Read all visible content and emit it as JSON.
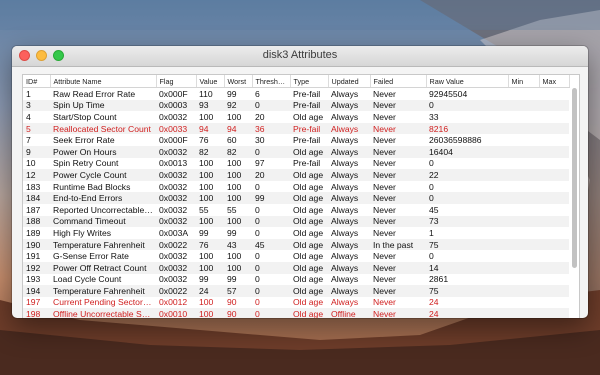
{
  "window": {
    "title": "disk3 Attributes"
  },
  "table": {
    "columns": [
      "ID#",
      "Attribute Name",
      "Flag",
      "Value",
      "Worst",
      "Threshold",
      "Type",
      "Updated",
      "Failed",
      "Raw Value",
      "Min",
      "Max"
    ],
    "rows": [
      {
        "id": "1",
        "name": "Raw Read Error Rate",
        "flag": "0x000F",
        "value": "110",
        "worst": "99",
        "threshold": "6",
        "type": "Pre-fail",
        "updated": "Always",
        "failed": "Never",
        "raw": "92945504",
        "min": "",
        "max": "",
        "warn": false
      },
      {
        "id": "3",
        "name": "Spin Up Time",
        "flag": "0x0003",
        "value": "93",
        "worst": "92",
        "threshold": "0",
        "type": "Pre-fail",
        "updated": "Always",
        "failed": "Never",
        "raw": "0",
        "min": "",
        "max": "",
        "warn": false
      },
      {
        "id": "4",
        "name": "Start/Stop Count",
        "flag": "0x0032",
        "value": "100",
        "worst": "100",
        "threshold": "20",
        "type": "Old age",
        "updated": "Always",
        "failed": "Never",
        "raw": "33",
        "min": "",
        "max": "",
        "warn": false
      },
      {
        "id": "5",
        "name": "Reallocated Sector Count",
        "flag": "0x0033",
        "value": "94",
        "worst": "94",
        "threshold": "36",
        "type": "Pre-fail",
        "updated": "Always",
        "failed": "Never",
        "raw": "8216",
        "min": "",
        "max": "",
        "warn": true
      },
      {
        "id": "7",
        "name": "Seek Error Rate",
        "flag": "0x000F",
        "value": "76",
        "worst": "60",
        "threshold": "30",
        "type": "Pre-fail",
        "updated": "Always",
        "failed": "Never",
        "raw": "26036598886",
        "min": "",
        "max": "",
        "warn": false
      },
      {
        "id": "9",
        "name": "Power On Hours",
        "flag": "0x0032",
        "value": "82",
        "worst": "82",
        "threshold": "0",
        "type": "Old age",
        "updated": "Always",
        "failed": "Never",
        "raw": "16404",
        "min": "",
        "max": "",
        "warn": false
      },
      {
        "id": "10",
        "name": "Spin Retry Count",
        "flag": "0x0013",
        "value": "100",
        "worst": "100",
        "threshold": "97",
        "type": "Pre-fail",
        "updated": "Always",
        "failed": "Never",
        "raw": "0",
        "min": "",
        "max": "",
        "warn": false
      },
      {
        "id": "12",
        "name": "Power Cycle Count",
        "flag": "0x0032",
        "value": "100",
        "worst": "100",
        "threshold": "20",
        "type": "Old age",
        "updated": "Always",
        "failed": "Never",
        "raw": "22",
        "min": "",
        "max": "",
        "warn": false
      },
      {
        "id": "183",
        "name": "Runtime Bad Blocks",
        "flag": "0x0032",
        "value": "100",
        "worst": "100",
        "threshold": "0",
        "type": "Old age",
        "updated": "Always",
        "failed": "Never",
        "raw": "0",
        "min": "",
        "max": "",
        "warn": false
      },
      {
        "id": "184",
        "name": "End-to-End Errors",
        "flag": "0x0032",
        "value": "100",
        "worst": "100",
        "threshold": "99",
        "type": "Old age",
        "updated": "Always",
        "failed": "Never",
        "raw": "0",
        "min": "",
        "max": "",
        "warn": false
      },
      {
        "id": "187",
        "name": "Reported Uncorrectable Errors",
        "flag": "0x0032",
        "value": "55",
        "worst": "55",
        "threshold": "0",
        "type": "Old age",
        "updated": "Always",
        "failed": "Never",
        "raw": "45",
        "min": "",
        "max": "",
        "warn": false
      },
      {
        "id": "188",
        "name": "Command Timeout",
        "flag": "0x0032",
        "value": "100",
        "worst": "100",
        "threshold": "0",
        "type": "Old age",
        "updated": "Always",
        "failed": "Never",
        "raw": "73",
        "min": "",
        "max": "",
        "warn": false
      },
      {
        "id": "189",
        "name": "High Fly Writes",
        "flag": "0x003A",
        "value": "99",
        "worst": "99",
        "threshold": "0",
        "type": "Old age",
        "updated": "Always",
        "failed": "Never",
        "raw": "1",
        "min": "",
        "max": "",
        "warn": false
      },
      {
        "id": "190",
        "name": "Temperature Fahrenheit",
        "flag": "0x0022",
        "value": "76",
        "worst": "43",
        "threshold": "45",
        "type": "Old age",
        "updated": "Always",
        "failed": "In the past",
        "raw": "75",
        "min": "",
        "max": "",
        "warn": false
      },
      {
        "id": "191",
        "name": "G-Sense Error Rate",
        "flag": "0x0032",
        "value": "100",
        "worst": "100",
        "threshold": "0",
        "type": "Old age",
        "updated": "Always",
        "failed": "Never",
        "raw": "0",
        "min": "",
        "max": "",
        "warn": false
      },
      {
        "id": "192",
        "name": "Power Off Retract Count",
        "flag": "0x0032",
        "value": "100",
        "worst": "100",
        "threshold": "0",
        "type": "Old age",
        "updated": "Always",
        "failed": "Never",
        "raw": "14",
        "min": "",
        "max": "",
        "warn": false
      },
      {
        "id": "193",
        "name": "Load Cycle Count",
        "flag": "0x0032",
        "value": "99",
        "worst": "99",
        "threshold": "0",
        "type": "Old age",
        "updated": "Always",
        "failed": "Never",
        "raw": "2861",
        "min": "",
        "max": "",
        "warn": false
      },
      {
        "id": "194",
        "name": "Temperature Fahrenheit",
        "flag": "0x0022",
        "value": "24",
        "worst": "57",
        "threshold": "0",
        "type": "Old age",
        "updated": "Always",
        "failed": "Never",
        "raw": "75",
        "min": "",
        "max": "",
        "warn": false
      },
      {
        "id": "197",
        "name": "Current Pending Sector Count",
        "flag": "0x0012",
        "value": "100",
        "worst": "90",
        "threshold": "0",
        "type": "Old age",
        "updated": "Always",
        "failed": "Never",
        "raw": "24",
        "min": "",
        "max": "",
        "warn": true
      },
      {
        "id": "198",
        "name": "Offline Uncorrectable Sector Count",
        "flag": "0x0010",
        "value": "100",
        "worst": "90",
        "threshold": "0",
        "type": "Old age",
        "updated": "Offline",
        "failed": "Never",
        "raw": "24",
        "min": "",
        "max": "",
        "warn": true
      }
    ]
  }
}
